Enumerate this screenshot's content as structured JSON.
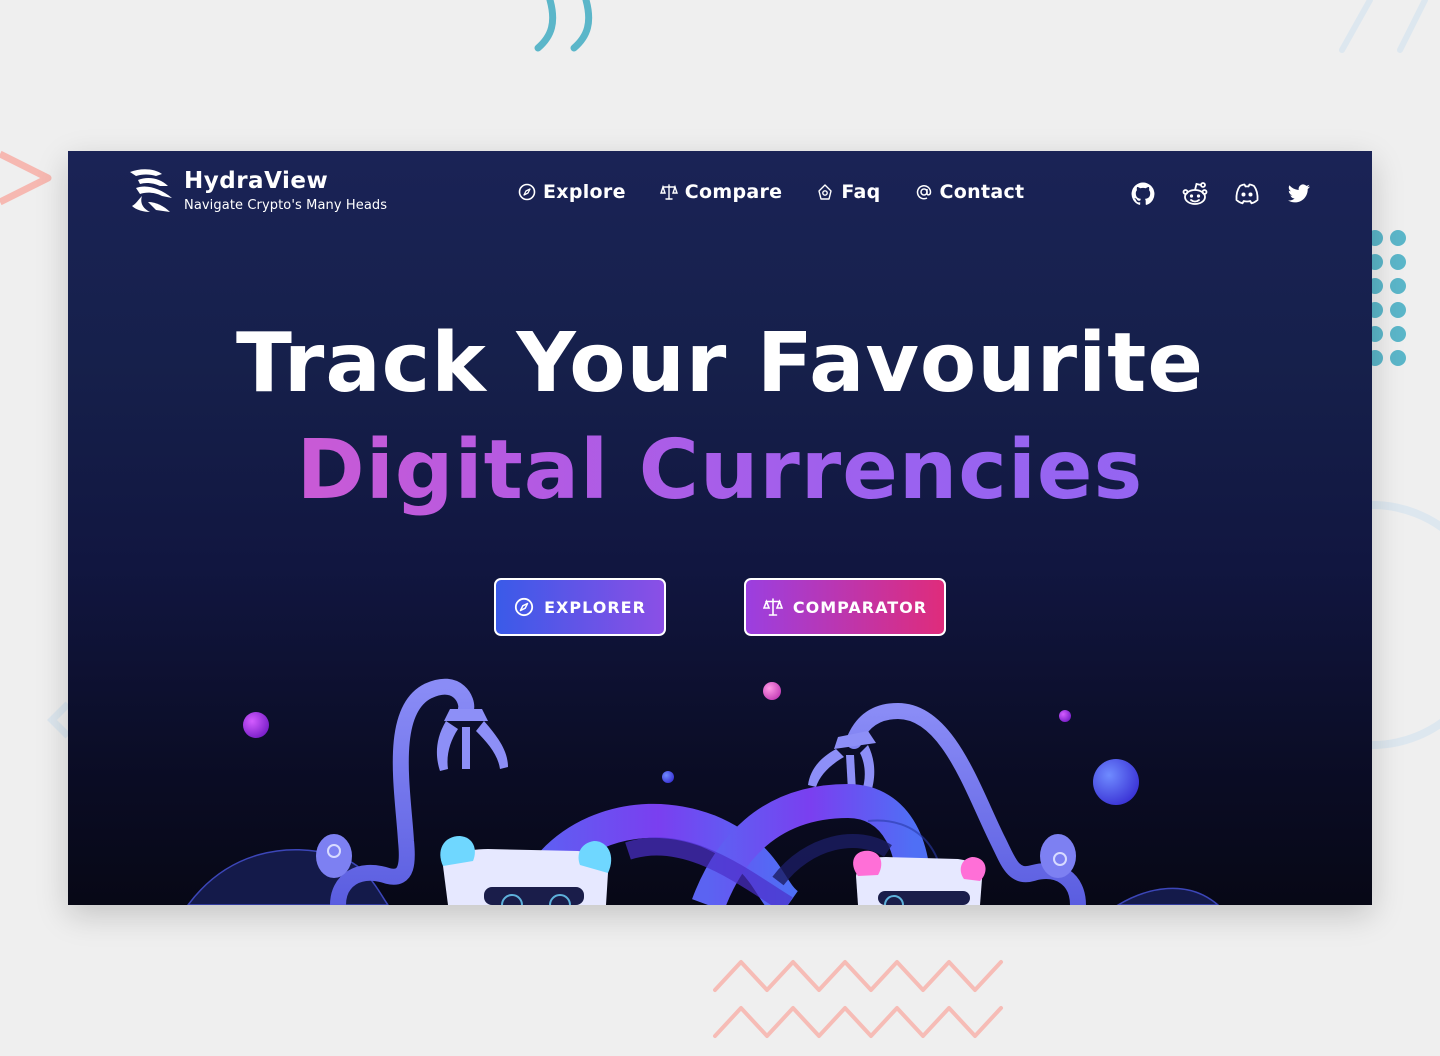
{
  "brand": {
    "name": "HydraView",
    "tagline": "Navigate Crypto's Many Heads",
    "logo_icon": "hydra-logo-icon"
  },
  "nav": {
    "items": [
      {
        "label": "Explore",
        "icon": "compass-icon"
      },
      {
        "label": "Compare",
        "icon": "scales-icon"
      },
      {
        "label": "Faq",
        "icon": "flower-icon"
      },
      {
        "label": "Contact",
        "icon": "at-icon"
      }
    ]
  },
  "socials": [
    {
      "name": "github-icon"
    },
    {
      "name": "reddit-icon"
    },
    {
      "name": "discord-icon"
    },
    {
      "name": "twitter-icon"
    }
  ],
  "hero": {
    "line1": "Track Your Favourite",
    "line2": "Digital Currencies"
  },
  "buttons": {
    "explorer": {
      "label": "EXPLORER",
      "icon": "compass-icon"
    },
    "comparator": {
      "label": "COMPARATOR",
      "icon": "scales-icon"
    }
  },
  "colors": {
    "card_top": "#1a2356",
    "card_bottom": "#070816",
    "accent_pink": "#e05bc8",
    "accent_purple": "#8f68f3",
    "explorer_button": "#3a5ae8",
    "comparator_button": "#df2c7b",
    "deco_teal": "#5bb6c9",
    "deco_salmon": "#f4a9a4"
  }
}
